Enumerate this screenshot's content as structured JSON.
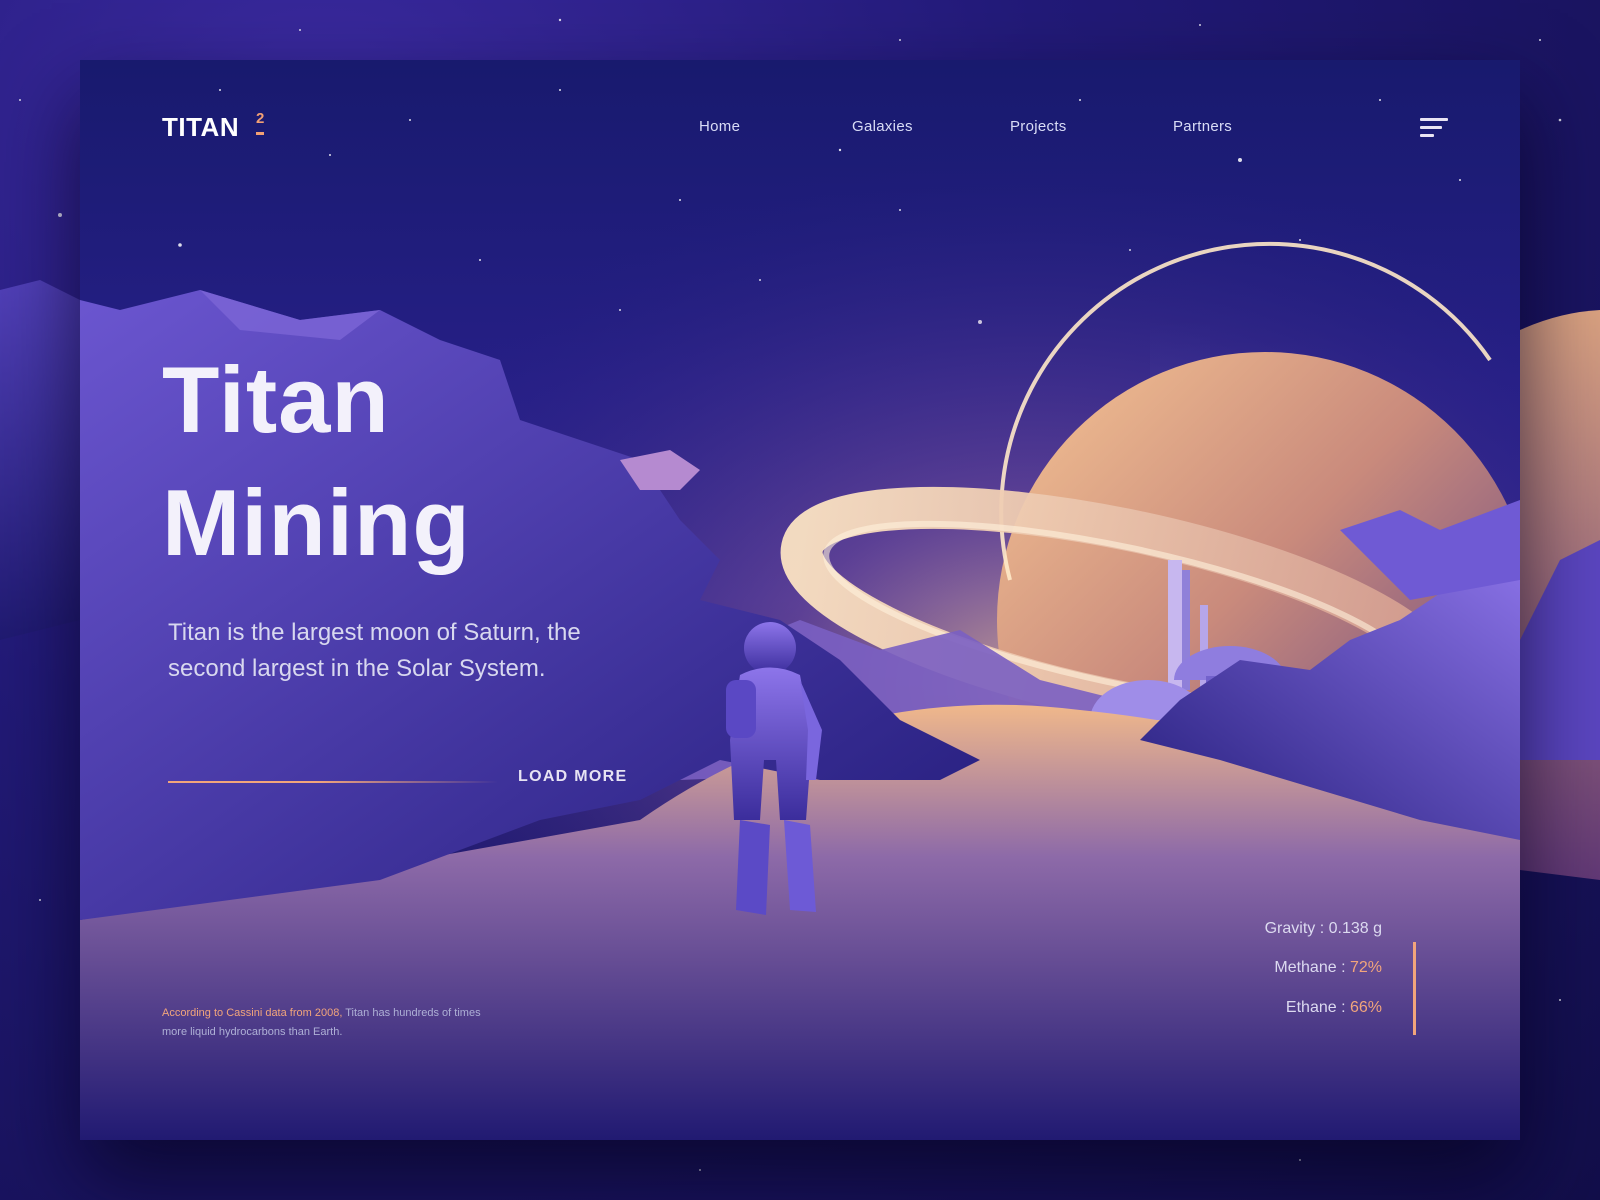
{
  "logo": {
    "text": "TITAN",
    "mark": "2"
  },
  "nav": {
    "items": [
      {
        "label": "Home"
      },
      {
        "label": "Galaxies"
      },
      {
        "label": "Projects"
      },
      {
        "label": "Partners"
      }
    ],
    "menu_icon": "hamburger-menu-icon"
  },
  "hero": {
    "title_line1": "Titan",
    "title_line2": "Mining",
    "subtitle": "Titan is the largest moon of Saturn, the second largest in the Solar System.",
    "cta_label": "LOAD MORE"
  },
  "note": {
    "highlight": "According to Cassini data from 2008,",
    "text": " Titan has hundreds of times more liquid hydrocarbons than Earth."
  },
  "stats": [
    {
      "label": "Gravity : ",
      "value": "0.138 g",
      "accent": false
    },
    {
      "label": "Methane : ",
      "value": "72%",
      "accent": true
    },
    {
      "label": "Ethane : ",
      "value": "66%",
      "accent": true
    }
  ],
  "colors": {
    "accent": "#f2a57b",
    "background": "#1d1768",
    "text": "#f3f1fb"
  }
}
